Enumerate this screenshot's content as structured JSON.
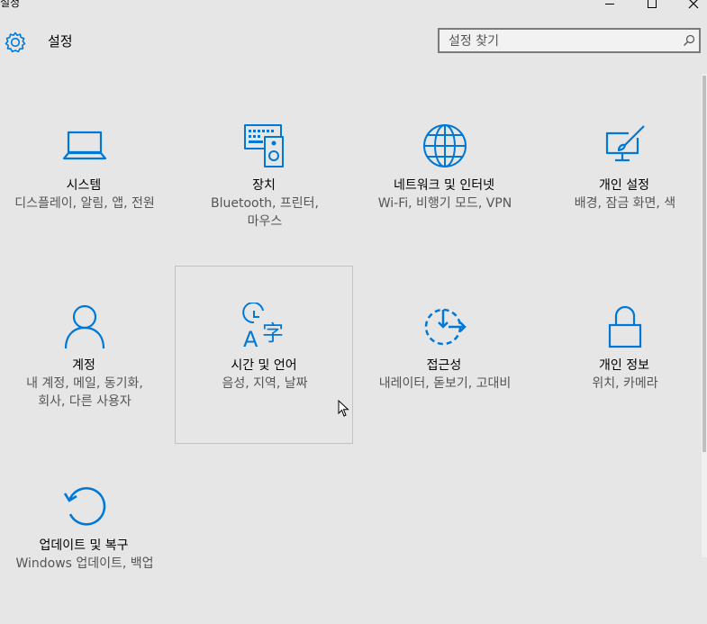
{
  "window": {
    "title": "설정",
    "controls": {
      "minimize_icon": "minimize-icon",
      "maximize_icon": "maximize-icon",
      "close_icon": "close-icon"
    }
  },
  "header": {
    "title": "설정",
    "icon": "gear-icon",
    "search": {
      "placeholder": "설정 찾기",
      "value": "",
      "icon": "search-icon"
    }
  },
  "colors": {
    "accent": "#0078d7",
    "background": "#e6e6e6",
    "description": "#555555"
  },
  "tiles": [
    {
      "title": "시스템",
      "description": "디스플레이, 알림, 앱, 전원",
      "icon": "laptop-icon"
    },
    {
      "title": "장치",
      "description": "Bluetooth, 프린터, 마우스",
      "icon": "devices-icon"
    },
    {
      "title": "네트워크 및 인터넷",
      "description": "Wi-Fi, 비행기 모드, VPN",
      "icon": "globe-icon"
    },
    {
      "title": "개인 설정",
      "description": "배경, 잠금 화면, 색",
      "icon": "personalization-icon"
    },
    {
      "title": "계정",
      "description": "내 계정, 메일, 동기화, 회사, 다른 사용자",
      "icon": "person-icon"
    },
    {
      "title": "시간 및 언어",
      "description": "음성, 지역, 날짜",
      "icon": "time-language-icon"
    },
    {
      "title": "접근성",
      "description": "내레이터, 돋보기, 고대비",
      "icon": "ease-of-access-icon"
    },
    {
      "title": "개인 정보",
      "description": "위치, 카메라",
      "icon": "lock-icon"
    },
    {
      "title": "업데이트 및 복구",
      "description": "Windows 업데이트, 백업",
      "icon": "update-icon"
    }
  ]
}
